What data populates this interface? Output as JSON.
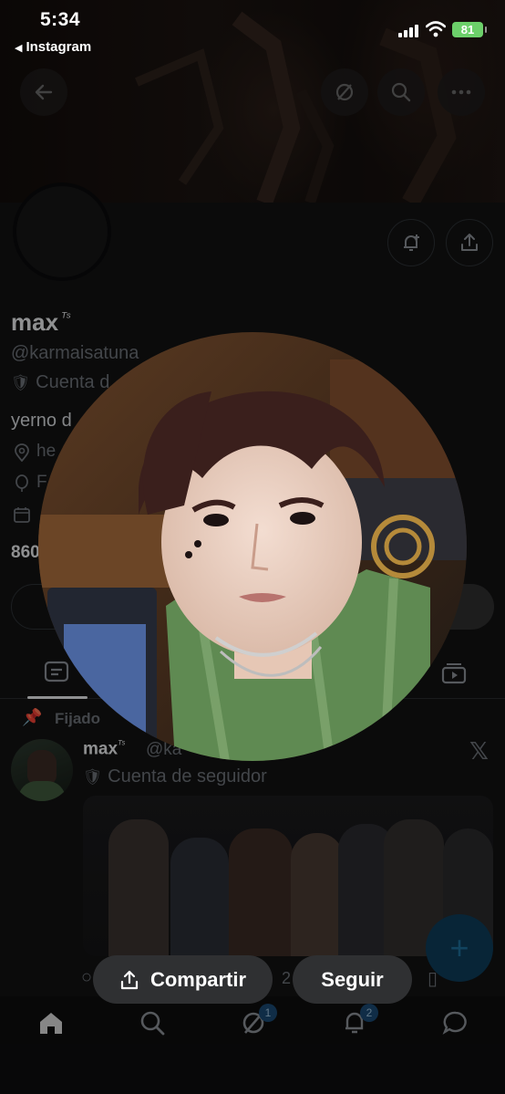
{
  "status_bar": {
    "time": "5:34",
    "back_app": "Instagram",
    "battery": "81"
  },
  "banner_controls": {
    "back_icon": "arrow-left-icon",
    "grok_icon": "slash-circle-icon",
    "search_icon": "search-icon",
    "more_icon": "more-dots-icon"
  },
  "profile": {
    "name": "max",
    "name_superscript": "ᵀˢ",
    "handle": "@karmaisatuna",
    "account_type": "Cuenta d",
    "bio": "yerno d",
    "location": "he",
    "website": "F",
    "stat_count": "860"
  },
  "pinned_post": {
    "pinned_label": "Fijado",
    "author_name": "max",
    "author_superscript": "ᵀˢ",
    "author_handle": "@ka",
    "account_type": "Cuenta de seguidor",
    "platform_icon": "x-logo-icon",
    "reply_count": "2"
  },
  "overlay": {
    "share_label": "Compartir",
    "follow_label": "Seguir"
  },
  "bottom_nav": {
    "items": [
      "home",
      "search",
      "grok",
      "notifications",
      "messages"
    ],
    "grok_badge": "1",
    "notifications_badge": "2"
  },
  "colors": {
    "background": "#121213",
    "accent_blue": "#1d9bf0",
    "muted_text": "#6d7278",
    "battery_green": "#6cd06a"
  }
}
